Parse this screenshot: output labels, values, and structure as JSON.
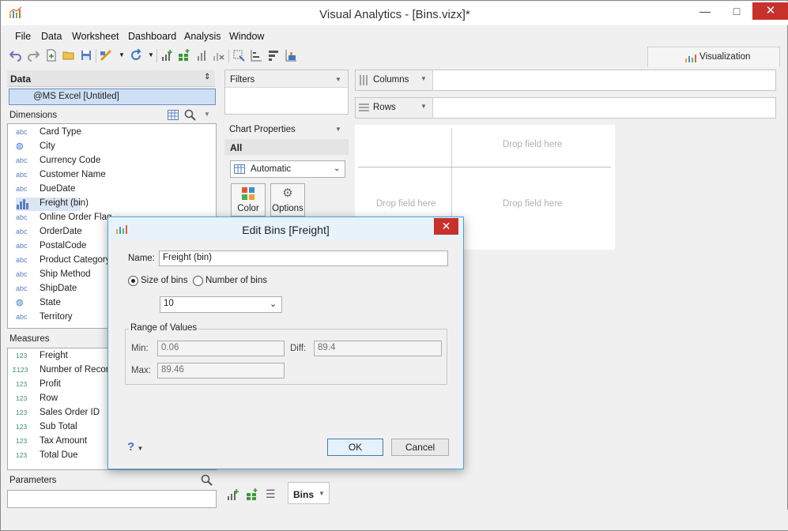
{
  "window": {
    "title": "Visual Analytics - [Bins.vizx]*",
    "minimize": "—",
    "maximize": "□",
    "close": "✕"
  },
  "menu": [
    "File",
    "Data",
    "Worksheet",
    "Dashboard",
    "Analysis",
    "Window"
  ],
  "toolbar": {
    "visualization_tab": "Visualization"
  },
  "data_panel": {
    "title": "Data",
    "datasource": "@MS Excel [Untitled]",
    "dimensions_title": "Dimensions",
    "dimensions": [
      {
        "icon": "abc",
        "label": "Card Type"
      },
      {
        "icon": "globe",
        "label": "City"
      },
      {
        "icon": "abc",
        "label": "Currency Code"
      },
      {
        "icon": "abc",
        "label": "Customer Name"
      },
      {
        "icon": "abc",
        "label": "DueDate"
      },
      {
        "icon": "bin",
        "label": "Freight (bin)"
      },
      {
        "icon": "abc",
        "label": "Online Order Flag"
      },
      {
        "icon": "abc",
        "label": "OrderDate"
      },
      {
        "icon": "abc",
        "label": "PostalCode"
      },
      {
        "icon": "abc",
        "label": "Product Category"
      },
      {
        "icon": "abc",
        "label": "Ship Method"
      },
      {
        "icon": "abc",
        "label": "ShipDate"
      },
      {
        "icon": "globe",
        "label": "State"
      },
      {
        "icon": "abc",
        "label": "Territory"
      }
    ],
    "measures_title": "Measures",
    "measures": [
      {
        "icon": "123",
        "label": "Freight"
      },
      {
        "icon": "Σ123",
        "label": "Number of Records"
      },
      {
        "icon": "123",
        "label": "Profit"
      },
      {
        "icon": "123",
        "label": "Row"
      },
      {
        "icon": "123",
        "label": "Sales Order ID"
      },
      {
        "icon": "123",
        "label": "Sub Total"
      },
      {
        "icon": "123",
        "label": "Tax Amount"
      },
      {
        "icon": "123",
        "label": "Total Due"
      }
    ],
    "parameters_title": "Parameters"
  },
  "filters": {
    "title": "Filters"
  },
  "shelves": {
    "columns": "Columns",
    "rows": "Rows"
  },
  "chart_properties": {
    "title": "Chart Properties",
    "all": "All",
    "mark_type": "Automatic",
    "color_button": "Color",
    "options_button": "Options"
  },
  "canvas": {
    "drop_top_right": "Drop field here",
    "drop_bottom_left": "Drop field here",
    "drop_bottom_right": "Drop field here"
  },
  "sheet_tabs": {
    "active": "Bins"
  },
  "dialog": {
    "title": "Edit Bins [Freight]",
    "name_label": "Name:",
    "name_value": "Freight (bin)",
    "size_of_bins_label": "Size of bins",
    "number_of_bins_label": "Number of bins",
    "bin_size_value": "10",
    "range_group": "Range of Values",
    "min_label": "Min:",
    "min_value": "0.06",
    "diff_label": "Diff:",
    "diff_value": "89.4",
    "max_label": "Max:",
    "max_value": "89.46",
    "help": "?",
    "ok": "OK",
    "cancel": "Cancel"
  }
}
